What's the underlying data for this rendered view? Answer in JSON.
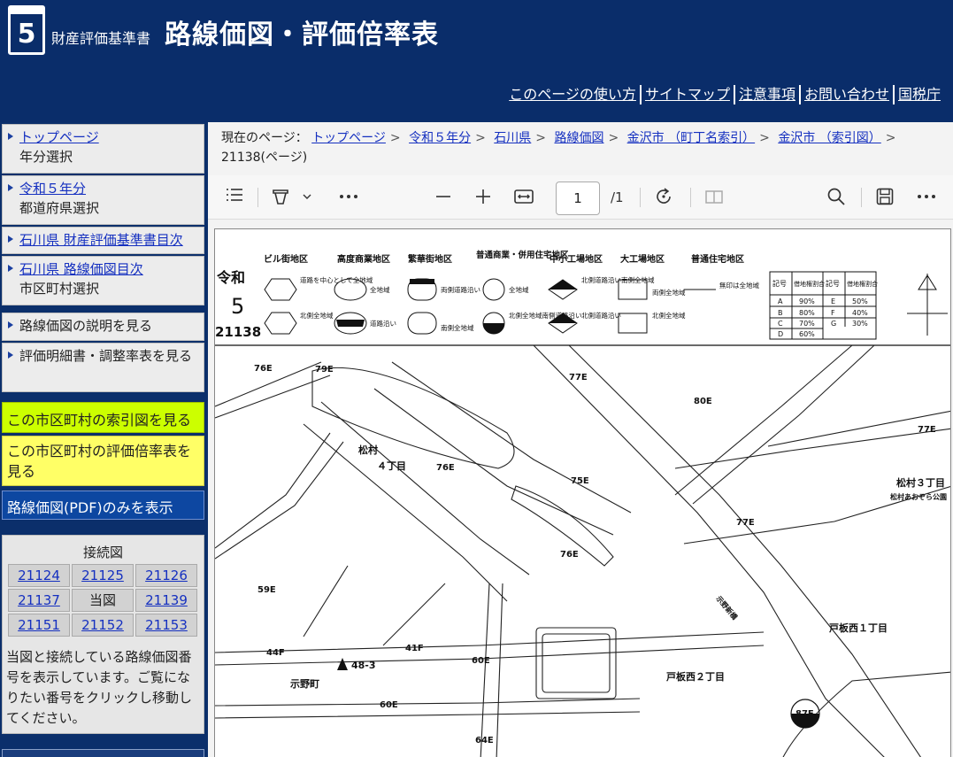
{
  "header": {
    "logo_number": "5",
    "subtitle": "財産評価基準書",
    "title": "路線価図・評価倍率表",
    "util_links": [
      "このページの使い方",
      "サイトマップ",
      "注意事項",
      "お問い合わせ",
      "国税庁"
    ]
  },
  "sidebar": {
    "items": [
      {
        "link": "トップページ",
        "sub": "年分選択"
      },
      {
        "link": "令和５年分",
        "sub": "都道府県選択"
      },
      {
        "link": "石川県 財産評価基準書目次",
        "sub": ""
      },
      {
        "link": "石川県 路線価図目次",
        "sub": "市区町村選択"
      },
      {
        "text": "路線価図の説明を見る"
      },
      {
        "text": "評価明細書・調整率表を見る"
      }
    ],
    "index_map": "この市区町村の索引図を見る",
    "multiplier": "この市区町村の評価倍率表を見る",
    "pdf_only": "路線価図(PDF)のみを表示",
    "adjacent": {
      "title": "接続図",
      "cells": [
        "21124",
        "21125",
        "21126",
        "21137",
        "当図",
        "21139",
        "21151",
        "21152",
        "21153"
      ],
      "note": "当図と接続している路線価図番号を表示しています。ご覧になりたい番号をクリックし移動してください。"
    }
  },
  "breadcrumb": {
    "label": "現在のページ：",
    "links": [
      "トップページ",
      "令和５年分",
      "石川県",
      "路線価図",
      "金沢市 （町丁名索引）",
      "金沢市 （索引図）"
    ],
    "current": "21138(ページ)"
  },
  "viewer": {
    "page_current": "1",
    "page_total": "/1",
    "icons": [
      "contents-icon",
      "draw-icon",
      "more-tools-icon",
      "zoom-out-icon",
      "zoom-in-icon",
      "fit-width-icon",
      "rotate-icon",
      "page-view-icon",
      "search-icon",
      "save-icon",
      "more-icon"
    ]
  },
  "map": {
    "era": "令和",
    "year": "5",
    "sheet_no": "21138",
    "zones": [
      "ビル街地区",
      "高度商業地区",
      "繁華街地区",
      "普通商業・併用住宅地区",
      "中小工場地区",
      "大工場地区",
      "普通住宅地区"
    ],
    "legend_row1": [
      "道路を中心として全地域",
      "全地域",
      "両側道路沿い",
      "全地域",
      "北側道路沿い南側全地域",
      "両側全地域",
      "無印は全地域"
    ],
    "legend_row2": [
      "北側全地域",
      "道路沿い",
      "南側全地域",
      "北側全地域南側道路沿い",
      "北側道路沿い",
      "北側全地域",
      ""
    ],
    "rate_table": {
      "headers": [
        "記号",
        "借地権割合",
        "記号",
        "借地権割合"
      ],
      "rows": [
        [
          "A",
          "90%",
          "E",
          "50%"
        ],
        [
          "B",
          "80%",
          "F",
          "40%"
        ],
        [
          "C",
          "70%",
          "G",
          "30%"
        ],
        [
          "D",
          "60%",
          "",
          ""
        ]
      ]
    },
    "place_names": [
      "松村",
      "４丁目",
      "松村３丁目",
      "松村あおぞら公園",
      "戸板西１丁目",
      "戸板西２丁目",
      "示野町"
    ],
    "road_prices": [
      "76E",
      "79E",
      "77E",
      "80E",
      "77E",
      "76E",
      "75E",
      "77E",
      "76E",
      "59E",
      "44F",
      "41F",
      "60E",
      "60E",
      "64E",
      "87E"
    ],
    "other_labels": [
      "48-3",
      "示野新橋"
    ]
  }
}
